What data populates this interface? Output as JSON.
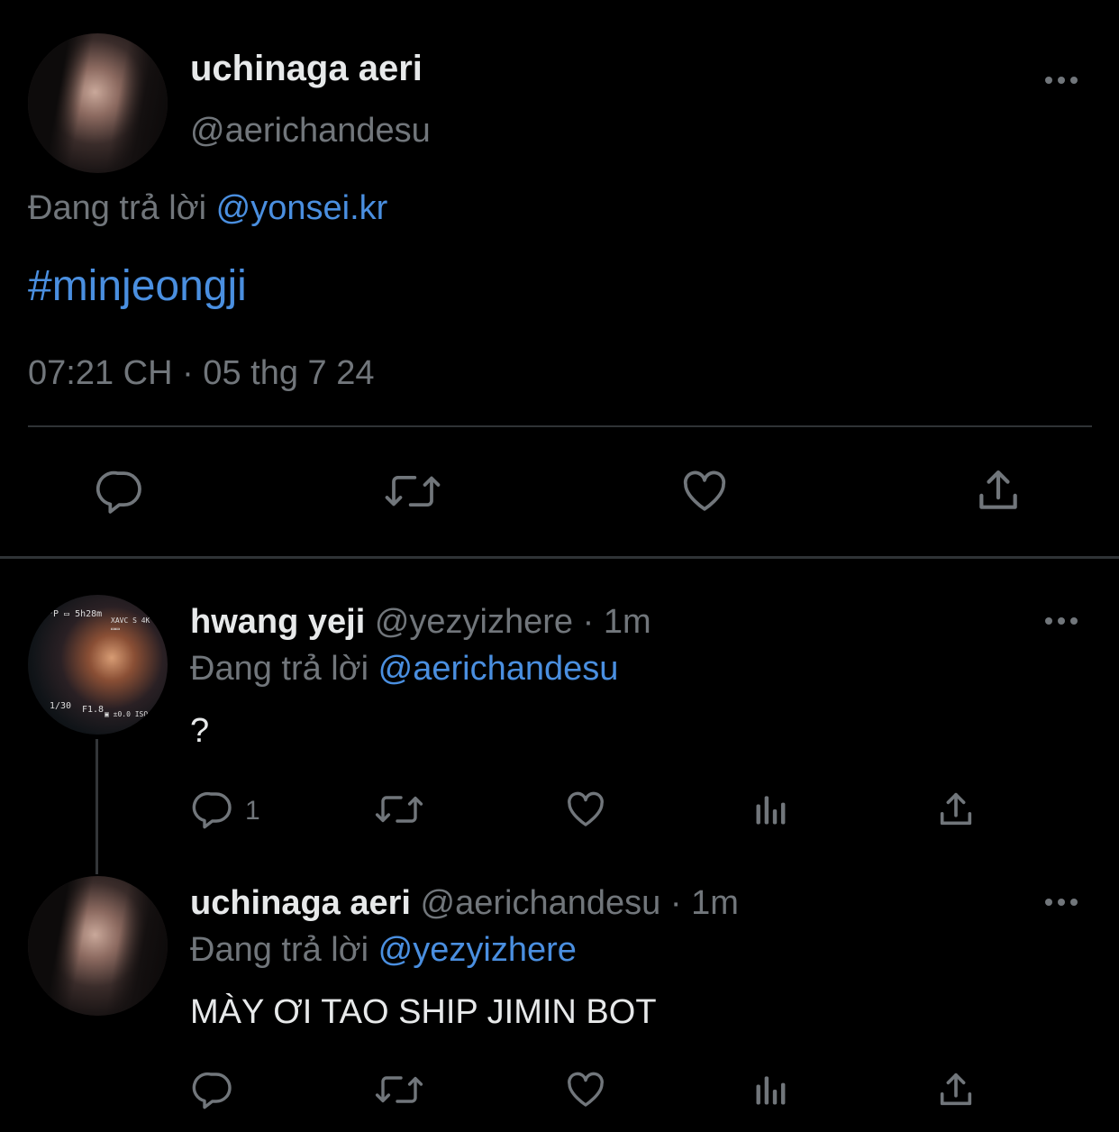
{
  "main_tweet": {
    "display_name": "uchinaga aeri",
    "handle": "@aerichandesu",
    "reply_prefix": "Đang trả lời",
    "reply_to": "@yonsei.kr",
    "text": "#minjeongji",
    "timestamp": "07:21 CH · 05 thg 7 24",
    "actions": {
      "reply_icon": "reply-icon",
      "retweet_icon": "retweet-icon",
      "like_icon": "heart-icon",
      "share_icon": "share-icon"
    }
  },
  "replies": [
    {
      "display_name": "hwang yeji",
      "handle": "@yezyizhere",
      "separator": "·",
      "time_ago": "1m",
      "reply_prefix": "Đang trả lời",
      "reply_to": "@aerichandesu",
      "text": "?",
      "reply_count": "1",
      "avatar_hud": {
        "top_left": "ᵃP ▭ 5h28m",
        "top_right": "XAVC S 4K 24p ▭▭",
        "bottom_left": "1/30",
        "bottom_mid": "F1.8",
        "bottom_right": "▣ ±0.0  ISO"
      }
    },
    {
      "display_name": "uchinaga aeri",
      "handle": "@aerichandesu",
      "separator": "·",
      "time_ago": "1m",
      "reply_prefix": "Đang trả lời",
      "reply_to": "@yezyizhere",
      "text": "MÀY ƠI TAO SHIP JIMIN BOT",
      "reply_count": ""
    }
  ],
  "colors": {
    "background": "#000000",
    "text": "#e7e9ea",
    "muted": "#71767b",
    "link": "#4a8fe0",
    "divider": "#2f3336"
  }
}
